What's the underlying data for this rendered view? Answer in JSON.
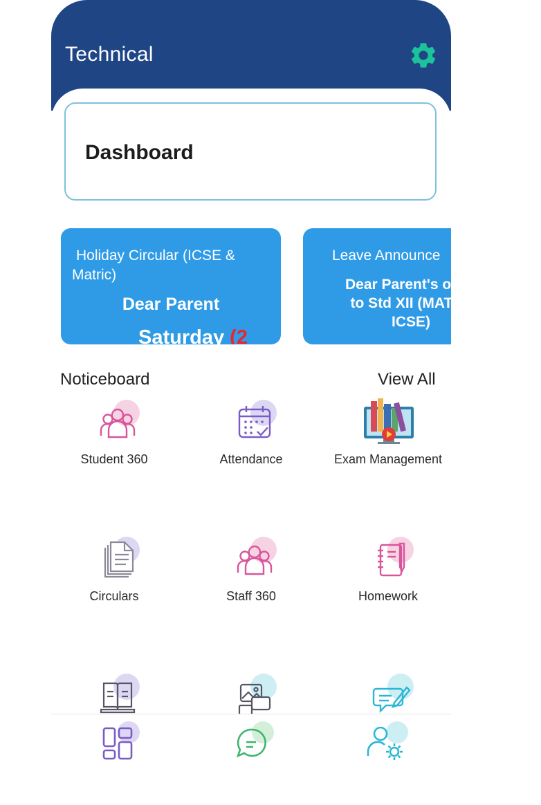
{
  "header": {
    "title": "Technical",
    "settings_icon": "gear-icon",
    "bg_color": "#1f4585",
    "icon_color": "#1bc29a"
  },
  "dashboard": {
    "title": "Dashboard"
  },
  "notices": [
    {
      "title": "Holiday Circular (ICSE & Matric)",
      "body": "Dear Parent",
      "highlight_text": "Saturday",
      "highlight_accent": "(2"
    },
    {
      "title": "Leave Announce",
      "body_lines": [
        "Dear Parent's of S",
        "to Std XII (MATR",
        "ICSE)"
      ]
    }
  ],
  "noticeboard": {
    "label": "Noticeboard",
    "view_all": "View All"
  },
  "modules": [
    {
      "label": "Student 360",
      "icon": "users-group-icon"
    },
    {
      "label": "Attendance",
      "icon": "calendar-check-icon"
    },
    {
      "label": "Exam Management",
      "icon": "books-monitor-icon"
    },
    {
      "label": "Circulars",
      "icon": "documents-icon"
    },
    {
      "label": "Staff 360",
      "icon": "users-group-icon"
    },
    {
      "label": "Homework",
      "icon": "notebook-pen-icon"
    },
    {
      "label": "",
      "icon": "e-book-icon"
    },
    {
      "label": "",
      "icon": "gallery-icon"
    },
    {
      "label": "",
      "icon": "message-edit-icon"
    }
  ],
  "bottom_nav": [
    {
      "icon": "dashboard-grid-icon"
    },
    {
      "icon": "chat-bubble-icon"
    },
    {
      "icon": "user-settings-icon"
    }
  ],
  "colors": {
    "notice_bg": "#2f9be7",
    "pink_icon": "#d9559b",
    "purple_icon": "#7a5cc7",
    "teal_icon": "#2ab7d6",
    "green_icon": "#3fb56f"
  }
}
